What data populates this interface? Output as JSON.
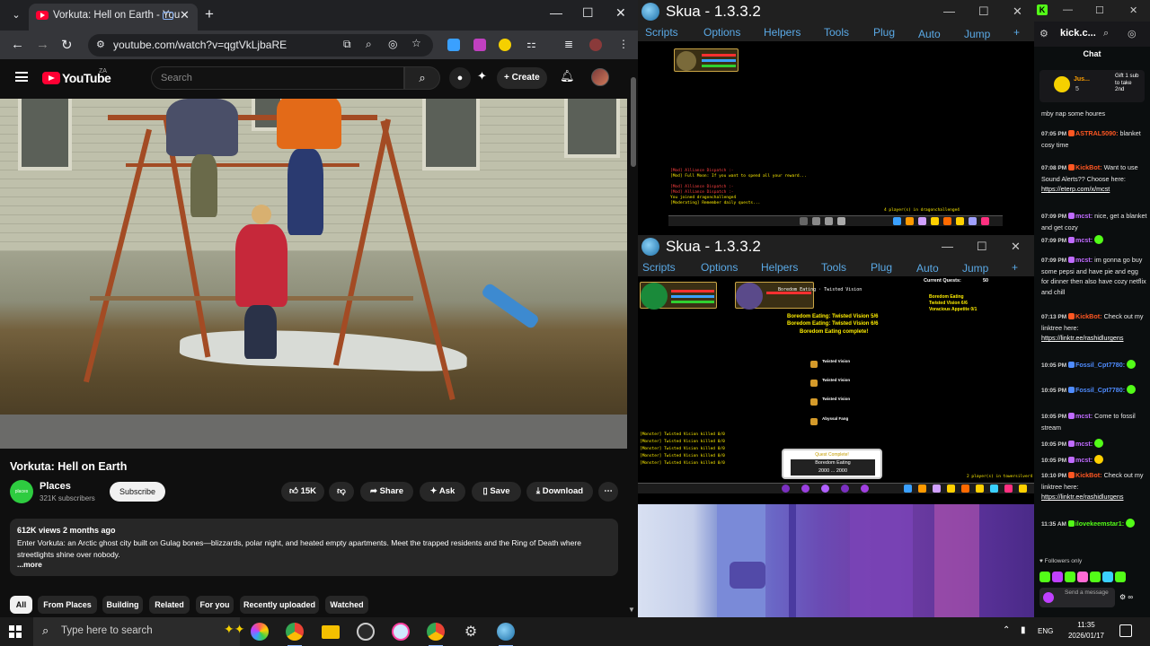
{
  "browser": {
    "tab_title": "Vorkuta: Hell on Earth - You",
    "url": "youtube.com/watch?v=qgtVkLjbaRE",
    "new_tab": "+",
    "window_controls": {
      "minimize": "—",
      "maximize": "☐",
      "close": "✕"
    }
  },
  "youtube": {
    "logo_text": "YouTube",
    "country_code": "ZA",
    "search_placeholder": "Search",
    "create_label": "+ Create",
    "video_title": "Vorkuta: Hell on Earth",
    "channel": {
      "name": "Places",
      "avatar_text": "places",
      "subscribers": "321K subscribers"
    },
    "subscribe_label": "Subscribe",
    "actions": {
      "like_count": "15K",
      "share": "Share",
      "ask": "Ask",
      "save": "Save",
      "download": "Download",
      "more": "⋯"
    },
    "description": {
      "meta": "612K views  2 months ago",
      "text": "Enter Vorkuta: an Arctic ghost city built on Gulag bones—blizzards, polar night, and heated empty apartments. Meet the trapped residents and the Ring of Death where streetlights shine over nobody.",
      "more": "...more"
    },
    "chips": [
      "All",
      "From Places",
      "Building",
      "Related",
      "For you",
      "Recently uploaded",
      "Watched"
    ]
  },
  "skua_top": {
    "title": "Skua - 1.3.3.2",
    "menu": [
      "Scripts",
      "Options",
      "Helpers",
      "Tools",
      "Plug",
      "Auto",
      "Jump",
      "+"
    ],
    "players_text": "4 player(s) in dragonchallenge4"
  },
  "skua_bottom": {
    "title": "Skua - 1.3.3.2",
    "menu": [
      "Scripts",
      "Options",
      "Helpers",
      "Tools",
      "Plug",
      "Auto",
      "Jump",
      "+"
    ],
    "current_quests_label": "Current Quests:",
    "quest_lines": [
      "Boredom Eating: Twisted Vision 5/6",
      "Boredom Eating: Twisted Vision 6/6",
      "Boredom Eating complete!"
    ],
    "quest_tracker": [
      "Boredom Eating",
      "Twisted Vision 6/6",
      "Voracious Appetite 0/1"
    ],
    "quest_items": [
      "Twisted Vision",
      "Twisted Vision",
      "Twisted Vision",
      "Abyssal Fang"
    ],
    "quest_complete_header": "Quest Complete!",
    "quest_complete_name": "Boredom Eating",
    "quest_complete_reward": "2000 ... 2000",
    "players_text": "2 player(s) in towersilver4"
  },
  "kick": {
    "url": "kick.c...",
    "chat_header": "Chat",
    "pinned": {
      "name": "Jus...",
      "count": "5",
      "gift_text": "Gift 1 sub to take 2nd"
    },
    "messages": [
      {
        "time": "",
        "user": "",
        "text": "mby nap some houres",
        "color": "#e8e8e8"
      },
      {
        "time": "07:05 PM",
        "user": "ASTRAL5090",
        "text": "blanket cosy time",
        "color": "#ff5722"
      },
      {
        "time": "07:08 PM",
        "user": "KickBot",
        "text": "Want to use Sound Alerts?? Choose here:",
        "link": "https://eterp.com/x/mcst",
        "color": "#ff5722"
      },
      {
        "time": "07:09 PM",
        "user": "mcst",
        "text": "nice, get a blanket and get cozy",
        "color": "#c06bff"
      },
      {
        "time": "07:09 PM",
        "user": "mcst",
        "text": "",
        "color": "#c06bff"
      },
      {
        "time": "07:09 PM",
        "user": "mcst",
        "text": "im gonna go buy some pepsi and have pie and egg for dinner then also have cozy netflix and chill",
        "color": "#c06bff"
      },
      {
        "time": "07:13 PM",
        "user": "KickBot",
        "text": "Check out my linktree here:",
        "link": "https://linktr.ee/rashidlurgens",
        "color": "#ff5722"
      },
      {
        "time": "10:05 PM",
        "user": "Fossil_Cpt7780",
        "text": "",
        "color": "#4f8cff"
      },
      {
        "time": "10:05 PM",
        "user": "Fossil_Cpt7780",
        "text": "",
        "color": "#4f8cff"
      },
      {
        "time": "10:05 PM",
        "user": "mcst",
        "text": "Come to fossil stream",
        "color": "#c06bff"
      },
      {
        "time": "10:05 PM",
        "user": "mcst",
        "text": "",
        "color": "#c06bff"
      },
      {
        "time": "10:05 PM",
        "user": "mcst",
        "text": "",
        "color": "#c06bff"
      },
      {
        "time": "10:10 PM",
        "user": "KickBot",
        "text": "Check out my linktree here:",
        "link": "https://linktr.ee/rashidlurgens",
        "color": "#ff5722"
      },
      {
        "time": "11:35 AM",
        "user": "ilovekeemstar1",
        "text": "",
        "color": "#53fc18"
      }
    ],
    "followers_only": "Followers only",
    "input_placeholder": "Send a message"
  },
  "taskbar": {
    "search_placeholder": "Type here to search",
    "language": "ENG",
    "time": "11:35",
    "date": "2026/01/17"
  }
}
